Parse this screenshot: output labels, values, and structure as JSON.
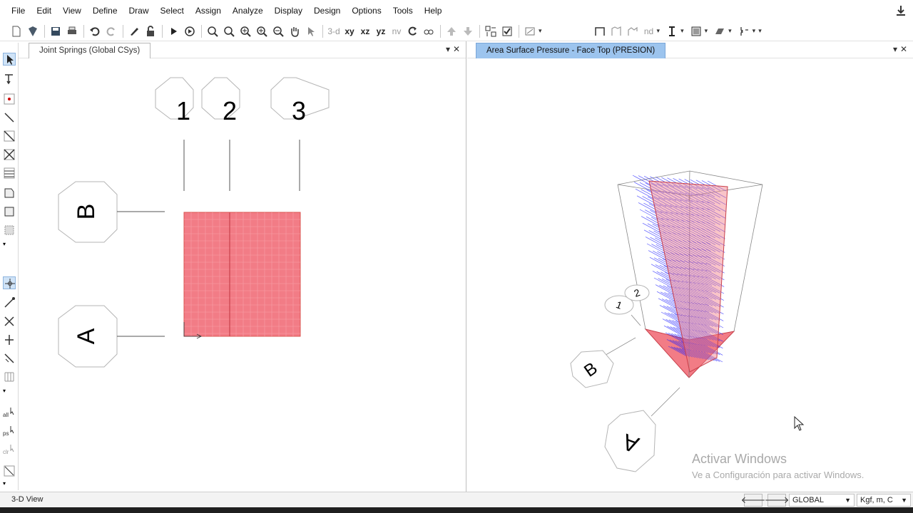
{
  "menu": {
    "items": [
      "File",
      "Edit",
      "View",
      "Define",
      "Draw",
      "Select",
      "Assign",
      "Analyze",
      "Display",
      "Design",
      "Options",
      "Tools",
      "Help"
    ]
  },
  "toolbar": {
    "view_3d": "3-d",
    "view_xy": "xy",
    "view_xz": "xz",
    "view_yz": "yz",
    "view_nv": "nv",
    "nd_label": "nd",
    "icons": [
      "new-file-icon",
      "open-icon",
      "save-icon",
      "print-icon",
      "undo-icon",
      "redo-icon",
      "pencil-icon",
      "lock-icon",
      "run-icon",
      "run-step-icon",
      "zoom-window-icon",
      "zoom-restore-icon",
      "zoom-in-icon",
      "zoom-in-step-icon",
      "zoom-out-icon",
      "pan-icon",
      "pointer-icon",
      "rotate-icon",
      "perspective-icon",
      "up-icon",
      "down-icon",
      "select-grid-icon",
      "checkbox-icon",
      "options-icon",
      "frame-icon",
      "shell-icon",
      "model-icon",
      "section-icon",
      "area-icon",
      "assign-icon",
      "spring-icon"
    ]
  },
  "left_panel": {
    "tab_title": "Joint Springs  (Global CSys)",
    "grid_labels_top": [
      "1",
      "2",
      "3"
    ],
    "grid_labels_side": [
      "B",
      "A"
    ],
    "area_color": "#f27c86"
  },
  "right_panel": {
    "tab_title": "Area Surface Pressure - Face Top (PRESION)",
    "grid_labels_top": [
      "1",
      "2"
    ],
    "grid_labels_side": [
      "B",
      "A"
    ],
    "load_color": "#2020ff",
    "area_color": "#f27c86"
  },
  "statusbar": {
    "view_label": "3-D View",
    "coord_system": "GLOBAL",
    "units": "Kgf, m, C"
  },
  "watermark": {
    "line1": "Activar Windows",
    "line2": "Ve a Configuración para activar Windows."
  }
}
